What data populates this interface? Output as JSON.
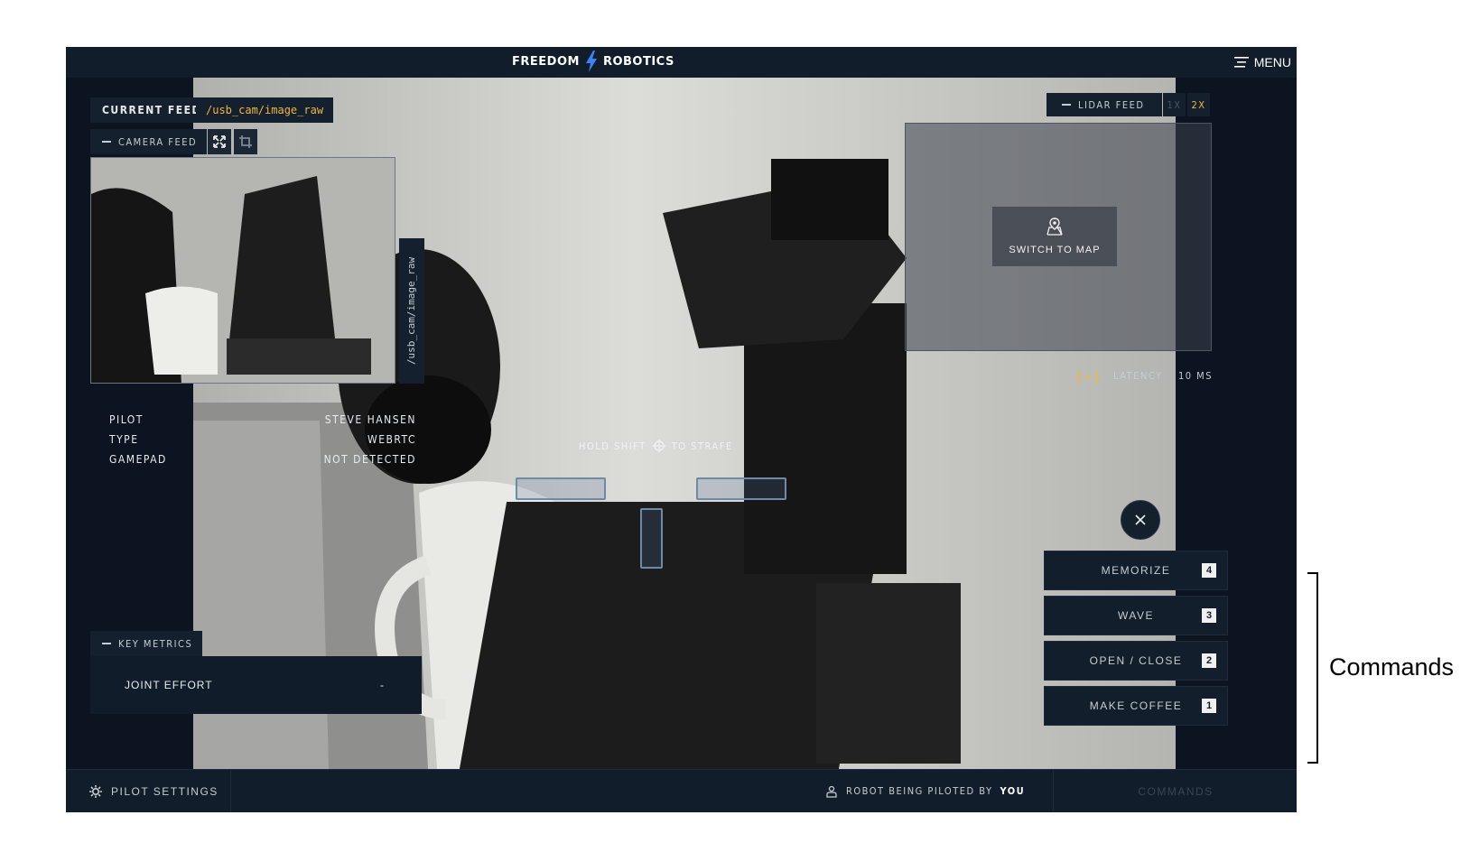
{
  "header": {
    "brand_left": "FREEDOM",
    "brand_right": "ROBOTICS",
    "menu_label": "MENU"
  },
  "feed": {
    "current_feed_label": "CURRENT FEED",
    "current_topic": "/usb_cam/image_raw",
    "camera_feed_label": "CAMERA FEED",
    "camera_side_topic": "/usb_cam/image_raw"
  },
  "session": {
    "rows": [
      {
        "label": "PILOT",
        "value": "STEVE HANSEN"
      },
      {
        "label": "TYPE",
        "value": "WEBRTC"
      },
      {
        "label": "GAMEPAD",
        "value": "NOT DETECTED"
      }
    ]
  },
  "metrics": {
    "tab_label": "KEY METRICS",
    "joint_effort_label": "JOINT EFFORT",
    "joint_effort_value": "-"
  },
  "lidar": {
    "tab_label": "LIDAR FEED",
    "zoom_1x": "1X",
    "zoom_2x": "2X",
    "switch_to_map": "SWITCH TO MAP"
  },
  "latency": {
    "label": "LATENCY",
    "value": "10 MS"
  },
  "strafe": {
    "pre": "HOLD SHIFT",
    "post": "TO STRAFE"
  },
  "commands": [
    {
      "label": "MEMORIZE",
      "key": "4"
    },
    {
      "label": "WAVE",
      "key": "3"
    },
    {
      "label": "OPEN / CLOSE",
      "key": "2"
    },
    {
      "label": "MAKE COFFEE",
      "key": "1"
    }
  ],
  "footer": {
    "pilot_settings": "PILOT SETTINGS",
    "piloted_by_text": "ROBOT BEING PILOTED BY",
    "piloted_by_who": "YOU",
    "commands_tab": "COMMANDS"
  },
  "annotation": {
    "commands_label": "Commands"
  },
  "colors": {
    "accent": "#f0b640",
    "panel": "#14202e",
    "background": "#0c1522"
  }
}
